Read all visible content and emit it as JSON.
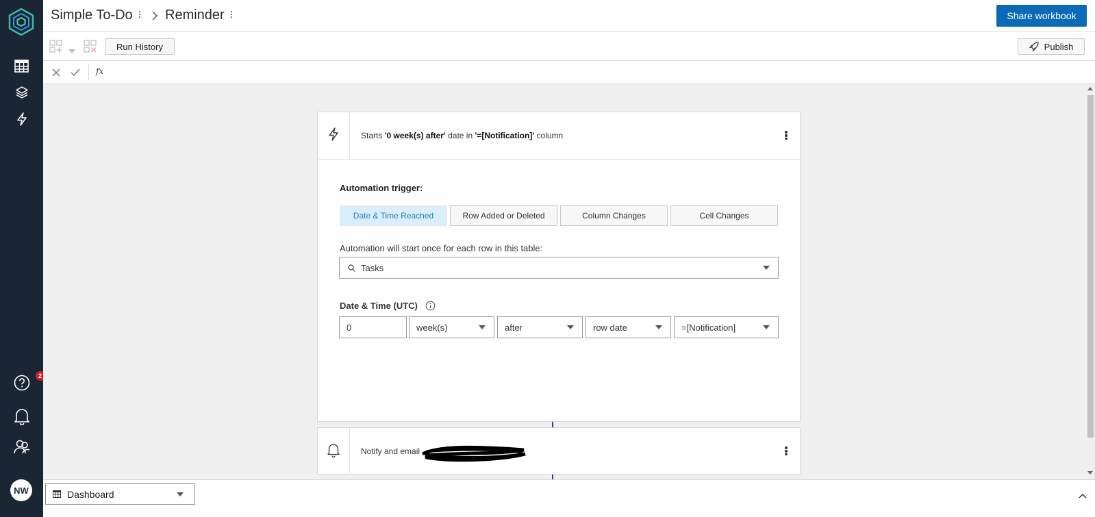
{
  "header": {
    "workbook_name": "Simple To-Do",
    "page_name": "Reminder",
    "share_label": "Share workbook"
  },
  "toolbar": {
    "run_history_label": "Run History",
    "publish_label": "Publish"
  },
  "formula_bar": {
    "fx_label": "fx"
  },
  "sidebar": {
    "help_badge": "2",
    "avatar_initials": "NW"
  },
  "trigger_card": {
    "summary_prefix": "Starts ",
    "summary_bold_1": "'0 week(s) after'",
    "summary_mid": " date in ",
    "summary_bold_2": "'=[Notification]'",
    "summary_suffix": " column",
    "section_title": "Automation trigger:",
    "tabs": [
      "Date & Time Reached",
      "Row Added or Deleted",
      "Column Changes",
      "Cell Changes"
    ],
    "active_tab": "Date & Time Reached",
    "table_label": "Automation will start once for each row in this table:",
    "table_value": "Tasks",
    "datetime_label": "Date & Time (UTC)",
    "offset_value": "0",
    "unit_value": "week(s)",
    "direction_value": "after",
    "reference_value": "row date",
    "column_value": "=[Notification]"
  },
  "action_card": {
    "summary_prefix": "Notify and email"
  },
  "bottom": {
    "sheet_name": "Dashboard"
  },
  "colors": {
    "rail_bg": "#1b2635",
    "accent": "#0b6bb8",
    "active_tab_bg": "#dceefb",
    "active_tab_text": "#1b82c5",
    "badge": "#d0212c"
  }
}
